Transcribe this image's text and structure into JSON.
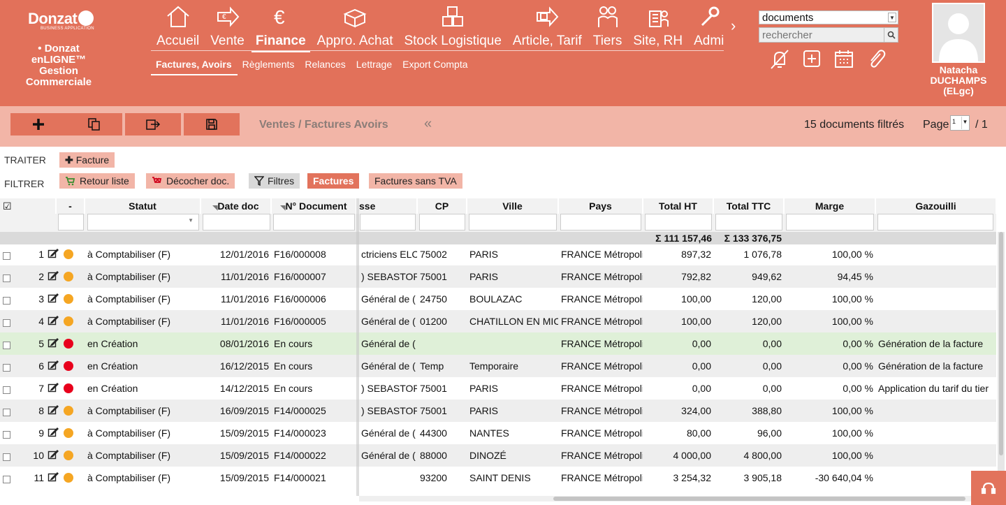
{
  "brand": {
    "logo_text": "Donzat",
    "logo_sub": "BUSINESS APPLICATION",
    "app_lines": [
      "• Donzat",
      "enLIGNE™",
      "Gestion",
      "Commerciale"
    ]
  },
  "nav": {
    "items": [
      {
        "label": "Accueil",
        "icon": "home-icon"
      },
      {
        "label": "Vente",
        "icon": "sale-icon"
      },
      {
        "label": "Finance",
        "icon": "euro-icon",
        "active": true
      },
      {
        "label": "Appro. Achat",
        "icon": "purchase-icon"
      },
      {
        "label": "Stock Logistique",
        "icon": "stock-icon"
      },
      {
        "label": "Article, Tarif",
        "icon": "article-icon"
      },
      {
        "label": "Tiers",
        "icon": "people-icon"
      },
      {
        "label": "Site, RH",
        "icon": "site-icon"
      },
      {
        "label": "Admi",
        "icon": "wrench-icon"
      }
    ],
    "next_glyph": "›",
    "subnav": [
      "Factures, Avoirs",
      "Règlements",
      "Relances",
      "Lettrage",
      "Export Compta"
    ]
  },
  "search": {
    "doc_type": "documents",
    "placeholder": "rechercher"
  },
  "user": {
    "name_line1": "Natacha",
    "name_line2": "DUCHAMPS",
    "name_line3": "(ELgc)"
  },
  "toolbar": {
    "breadcrumb": "Ventes / Factures Avoirs",
    "collapse_glyph": "«",
    "docs_count": "15 documents filtrés",
    "page_label": "Page",
    "page_value": "1",
    "page_total": "/ 1"
  },
  "actions": {
    "traiter_label": "TRAITER",
    "filtrer_label": "FILTRER",
    "facture_btn": "Facture",
    "retour_btn": "Retour liste",
    "decocher_btn": "Décocher doc.",
    "filtres_btn": "Filtres",
    "factures_btn": "Factures",
    "sans_tva_btn": "Factures sans TVA"
  },
  "grid": {
    "headers": {
      "check": "☑",
      "dash": "-",
      "statut": "Statut",
      "date": "Date doc",
      "numero": "N° Document",
      "adresse": "sse",
      "cp": "CP",
      "ville": "Ville",
      "pays": "Pays",
      "total_ht": "Total HT",
      "total_ttc": "Total TTC",
      "marge": "Marge",
      "gazouilli": "Gazouilli"
    },
    "sum_ht": "Σ 111 157,46",
    "sum_ttc": "Σ 133 376,75",
    "status_colors": {
      "orange": "#f5a623",
      "red": "#e8001c"
    },
    "rows": [
      {
        "n": "1",
        "dot": "orange",
        "statut": "à Comptabiliser (F)",
        "date": "12/01/2016",
        "num": "F16/000008",
        "adr": "ctriciens ELC",
        "cp": "75002",
        "ville": "PARIS",
        "pays": "FRANCE Métropoli",
        "ht": "897,32",
        "ttc": "1 076,78",
        "marge": "100,00 %",
        "gaz": ""
      },
      {
        "n": "2",
        "dot": "orange",
        "statut": "à Comptabiliser (F)",
        "date": "11/01/2016",
        "num": "F16/000007",
        "adr": ") SEBASTOPO",
        "cp": "75001",
        "ville": "PARIS",
        "pays": "FRANCE Métropoli",
        "ht": "792,82",
        "ttc": "949,62",
        "marge": "94,45 %",
        "gaz": ""
      },
      {
        "n": "3",
        "dot": "orange",
        "statut": "à Comptabiliser (F)",
        "date": "11/01/2016",
        "num": "F16/000006",
        "adr": "Général de (",
        "cp": "24750",
        "ville": "BOULAZAC",
        "pays": "FRANCE Métropoli",
        "ht": "100,00",
        "ttc": "120,00",
        "marge": "100,00 %",
        "gaz": ""
      },
      {
        "n": "4",
        "dot": "orange",
        "statut": "à Comptabiliser (F)",
        "date": "11/01/2016",
        "num": "F16/000005",
        "adr": "Général de (",
        "cp": "01200",
        "ville": "CHATILLON EN MIC",
        "pays": "FRANCE Métropoli",
        "ht": "100,00",
        "ttc": "120,00",
        "marge": "100,00 %",
        "gaz": ""
      },
      {
        "n": "5",
        "dot": "red",
        "statut": "en Création",
        "date": "08/01/2016",
        "num": "En cours",
        "adr": "Général de (",
        "cp": "",
        "ville": "",
        "pays": "FRANCE Métropoli",
        "ht": "0,00",
        "ttc": "0,00",
        "marge": "0,00 %",
        "gaz": "Génération de la facture"
      },
      {
        "n": "6",
        "dot": "red",
        "statut": "en Création",
        "date": "16/12/2015",
        "num": "En cours",
        "adr": "Général de (",
        "cp": "Temp",
        "ville": "Temporaire",
        "pays": "FRANCE Métropoli",
        "ht": "0,00",
        "ttc": "0,00",
        "marge": "0,00 %",
        "gaz": "Génération de la facture"
      },
      {
        "n": "7",
        "dot": "red",
        "statut": "en Création",
        "date": "14/12/2015",
        "num": "En cours",
        "adr": ") SEBASTOPO",
        "cp": "75001",
        "ville": "PARIS",
        "pays": "FRANCE Métropoli",
        "ht": "0,00",
        "ttc": "0,00",
        "marge": "0,00 %",
        "gaz": "Application du tarif du tier"
      },
      {
        "n": "8",
        "dot": "orange",
        "statut": "à Comptabiliser (F)",
        "date": "16/09/2015",
        "num": "F14/000025",
        "adr": ") SEBASTOPO",
        "cp": "75001",
        "ville": "PARIS",
        "pays": "FRANCE Métropoli",
        "ht": "324,00",
        "ttc": "388,80",
        "marge": "100,00 %",
        "gaz": ""
      },
      {
        "n": "9",
        "dot": "orange",
        "statut": "à Comptabiliser (F)",
        "date": "15/09/2015",
        "num": "F14/000023",
        "adr": "Général de (",
        "cp": "44300",
        "ville": "NANTES",
        "pays": "FRANCE Métropoli",
        "ht": "80,00",
        "ttc": "96,00",
        "marge": "100,00 %",
        "gaz": ""
      },
      {
        "n": "10",
        "dot": "orange",
        "statut": "à Comptabiliser (F)",
        "date": "15/09/2015",
        "num": "F14/000022",
        "adr": "Général de (",
        "cp": "88000",
        "ville": "DINOZÉ",
        "pays": "FRANCE Métropoli",
        "ht": "4 000,00",
        "ttc": "4 800,00",
        "marge": "100,00 %",
        "gaz": ""
      },
      {
        "n": "11",
        "dot": "orange",
        "statut": "à Comptabiliser (F)",
        "date": "15/09/2015",
        "num": "F14/000021",
        "adr": "",
        "cp": "93200",
        "ville": "SAINT DENIS",
        "pays": "FRANCE Métropoli",
        "ht": "3 254,32",
        "ttc": "3 905,18",
        "marge": "-30 640,04 %",
        "gaz": ""
      }
    ]
  }
}
